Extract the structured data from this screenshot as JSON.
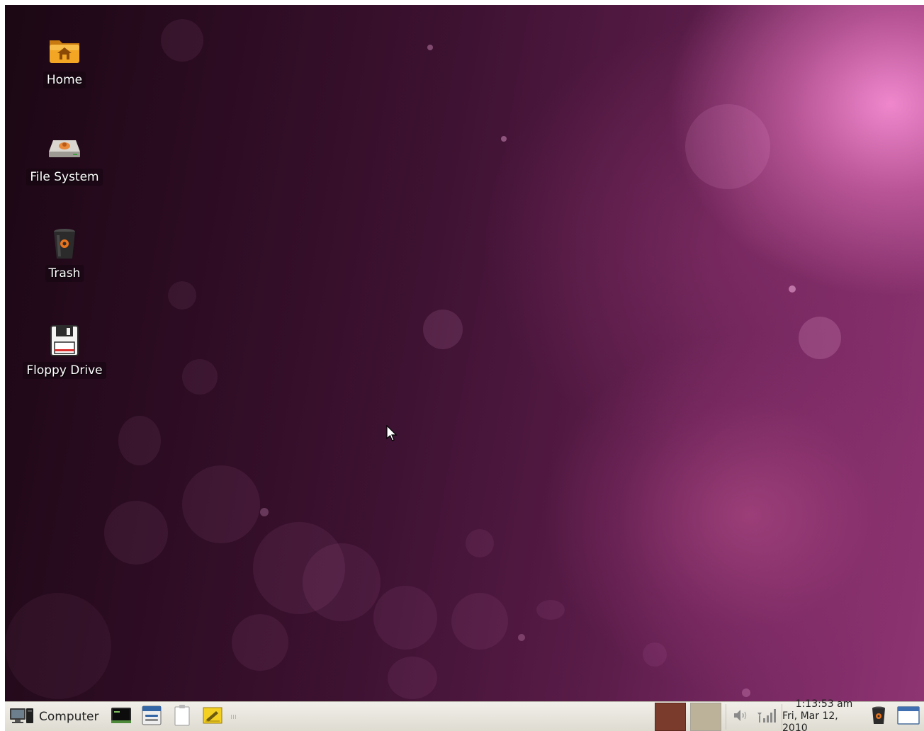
{
  "desktop": {
    "icons": [
      {
        "label": "Home",
        "icon": "home-folder-icon"
      },
      {
        "label": "File System",
        "icon": "hard-drive-icon"
      },
      {
        "label": "Trash",
        "icon": "trash-icon"
      },
      {
        "label": "Floppy Drive",
        "icon": "floppy-disk-icon"
      }
    ]
  },
  "panel": {
    "menu_label": "Computer",
    "launchers": [
      "terminal-icon",
      "file-manager-icon",
      "text-editor-icon",
      "notes-icon"
    ],
    "workspaces": [
      {
        "state": "active",
        "color": "#7a3a2c"
      },
      {
        "state": "inactive",
        "color": "#bcb29a"
      }
    ],
    "tray": [
      "volume-icon",
      "network-signal-icon"
    ],
    "clock": {
      "time": "1:13:53 am",
      "date": "Fri, Mar 12, 2010"
    },
    "right_icons": [
      "trash-applet-icon",
      "show-desktop-icon"
    ]
  }
}
